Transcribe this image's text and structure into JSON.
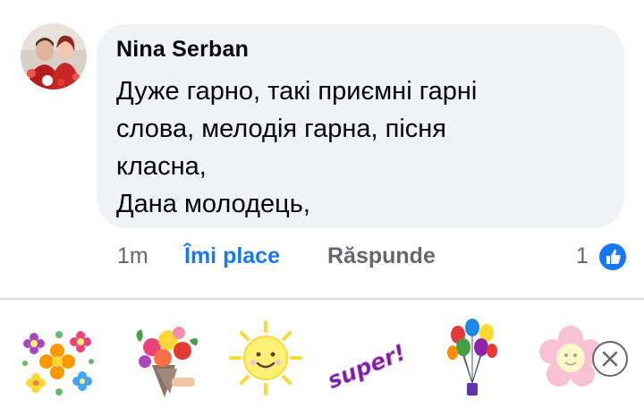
{
  "comment": {
    "author": "Nina Serban",
    "lines": [
      "Дуже гарно, такі приємні гарні",
      "слова, мелодія гарна, пісня",
      "класна,",
      "Дана молодець,"
    ],
    "time": "1m",
    "like_label": "Îmi place",
    "reply_label": "Răspunde",
    "reaction_count": "1",
    "reaction_icon": "thumbs-up-icon"
  },
  "stickers": [
    {
      "name": "flowers-sticker"
    },
    {
      "name": "bouquet-sticker"
    },
    {
      "name": "sun-sticker"
    },
    {
      "name": "super-sticker",
      "text": "super!"
    },
    {
      "name": "balloons-sticker"
    },
    {
      "name": "pink-flower-sticker"
    }
  ],
  "close_icon": "close-icon",
  "colors": {
    "accent": "#1877f2",
    "bubble": "#f0f2f5",
    "secondary_text": "#65676b"
  }
}
